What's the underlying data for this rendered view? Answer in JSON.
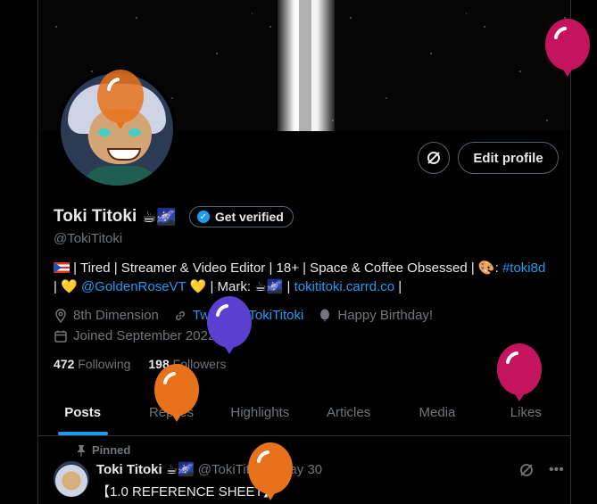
{
  "profile": {
    "name": "Toki Titoki",
    "name_emoji": "☕🌌",
    "handle": "@TokiTitoki",
    "verified_label": "Get verified",
    "edit_label": "Edit profile"
  },
  "bio": {
    "flag_icon": "puerto-rico-flag-icon",
    "line1_text": " | Tired | Streamer & Video Editor | 18+ | Space & Coffee Obsessed | 🎨: ",
    "hashtag": "#toki8d",
    "line2_heart1": "💛 ",
    "mention": "@GoldenRoseVT",
    "line2_mid": " 💛 | Mark: ☕🌌 | ",
    "website": "tokititoki.carrd.co",
    "line2_end": " |"
  },
  "meta": {
    "location": "8th Dimension",
    "url": "Twitch.tv/TokiTitoki",
    "birthday": "Happy Birthday!",
    "joined": "Joined September 2022"
  },
  "counts": {
    "following_num": "472",
    "following_label": "Following",
    "followers_num": "198",
    "followers_label": "Followers"
  },
  "tabs": [
    {
      "label": "Posts"
    },
    {
      "label": "Replies"
    },
    {
      "label": "Highlights"
    },
    {
      "label": "Articles"
    },
    {
      "label": "Media"
    },
    {
      "label": "Likes"
    }
  ],
  "post": {
    "pinned_label": "Pinned",
    "author": "Toki Titoki",
    "author_emoji": "☕🌌",
    "handle": "@TokiTitoki",
    "date": "May 30",
    "text": "【1.0 REFERENCE SHEET】"
  },
  "colors": {
    "accent": "#1d9bf0",
    "background": "#000000",
    "balloon_orange": "#e8721c",
    "balloon_purple": "#5b3fd1",
    "balloon_magenta": "#c4145e"
  }
}
